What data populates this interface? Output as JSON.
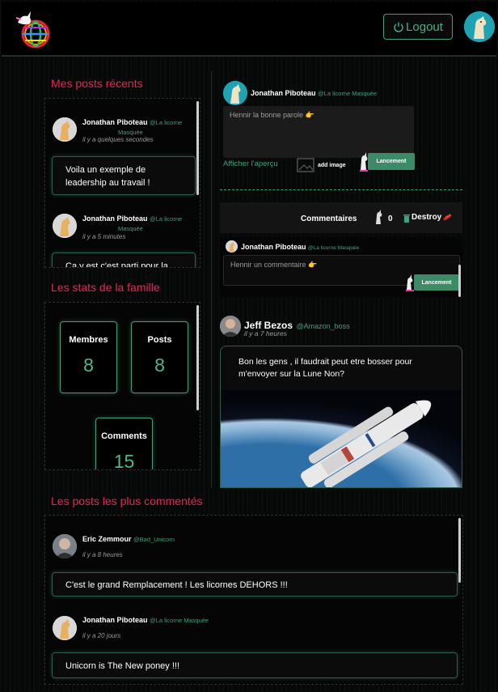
{
  "header": {
    "logout_label": "Logout",
    "logo_icon": "unicorn-globe-logo",
    "user_avatar_icon": "llama-avatar"
  },
  "recent_posts": {
    "title": "Mes posts récents",
    "items": [
      {
        "author": "Jonathan Piboteau",
        "handle": "@La licorne",
        "handle2": "Masquée",
        "time": "il y a quelques secondes",
        "text": "Voila un exemple de leadership au travail !"
      },
      {
        "author": "Jonathan Piboteau",
        "handle": "@La licorne",
        "handle2": "Masquée",
        "time": "il y a 5 minutes",
        "text": "Ca y est c'est parti pour la"
      }
    ]
  },
  "stats": {
    "title": "Les stats de la famille",
    "members_label": "Membres",
    "members_value": "8",
    "posts_label": "Posts",
    "posts_value": "8",
    "comments_label": "Comments",
    "comments_value": "15"
  },
  "composer": {
    "author": "Jonathan Piboteau",
    "handle": "@La licorne Masquée",
    "placeholder": "Hennir la bonne parole 👉",
    "preview_link": "Afficher l'aperçu",
    "add_image_label": "add image",
    "submit_label": "Lancement"
  },
  "comments_bar": {
    "label": "Commentaires",
    "count": "0",
    "destroy_label": "Destroy"
  },
  "comment_form": {
    "author": "Jonathan Piboteau",
    "handle": "@La licorne Masquée",
    "placeholder": "Hennir un commentaire 👉",
    "submit_label": "Lancement"
  },
  "feed_post": {
    "author": "Jeff Bezos",
    "handle": "@Amazon_boss",
    "time": "il y a 7 heures",
    "text": "Bon les gens , il faudrait peut etre bosser pour m'envoyer sur la Lune Non?"
  },
  "most_commented": {
    "title": "Les posts les plus commentés",
    "items": [
      {
        "author": "Eric Zemmour",
        "handle": "@Bad_Unicorn",
        "time": "il y a 8 heures",
        "text": "C'est le grand Remplacement ! Les licornes DEHORS !!!"
      },
      {
        "author": "Jonathan Piboteau",
        "handle": "@La licorne Masquée",
        "time": "il y a 20 jours",
        "text": "Unicorn is The New poney !!!"
      }
    ]
  },
  "colors": {
    "accent_green": "#3fa27a",
    "title_pink": "#e8235a",
    "background": "#050505"
  }
}
